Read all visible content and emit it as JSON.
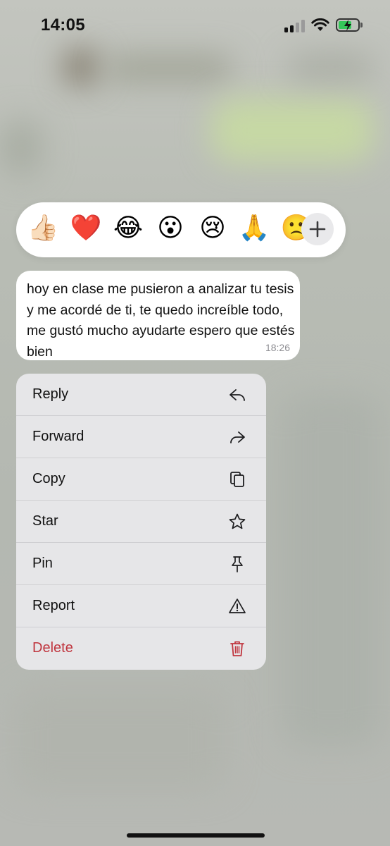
{
  "status_bar": {
    "time": "14:05"
  },
  "reactions": {
    "emojis": [
      {
        "name": "thumbs-up",
        "char": "👍🏻"
      },
      {
        "name": "red-heart",
        "char": "❤️"
      },
      {
        "name": "tears-of-joy",
        "char": "😂"
      },
      {
        "name": "surprised",
        "char": "😮"
      },
      {
        "name": "crying",
        "char": "😢"
      },
      {
        "name": "folded-hands",
        "char": "🙏"
      },
      {
        "name": "slightly-frowning",
        "char": "🙁"
      }
    ],
    "add_label": "+"
  },
  "message": {
    "text": "hoy en clase me pusieron a analizar tu tesis y me acordé de ti, te quedo increíble todo, me gustó mucho ayudarte espero que estés bien",
    "time": "18:26"
  },
  "menu": {
    "items": [
      {
        "label": "Reply",
        "icon": "reply-icon"
      },
      {
        "label": "Forward",
        "icon": "forward-icon"
      },
      {
        "label": "Copy",
        "icon": "copy-icon"
      },
      {
        "label": "Star",
        "icon": "star-icon"
      },
      {
        "label": "Pin",
        "icon": "pin-icon"
      },
      {
        "label": "Report",
        "icon": "warning-icon"
      },
      {
        "label": "Delete",
        "icon": "trash-icon"
      }
    ]
  },
  "colors": {
    "delete": "#c0363f",
    "battery": "#35c759",
    "menu_bg": "#e6e6e8"
  }
}
